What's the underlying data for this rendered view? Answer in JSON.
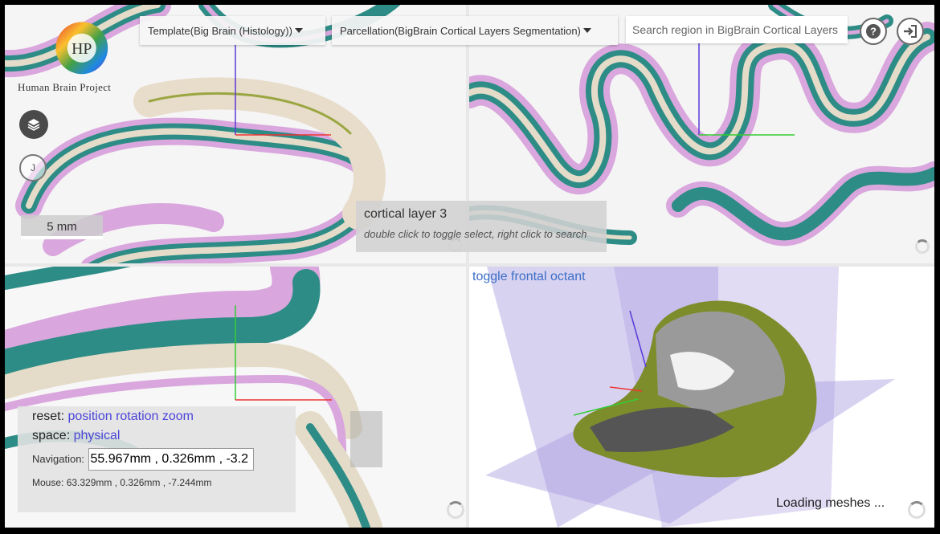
{
  "logo": {
    "initials": "HP",
    "text": "Human Brain Project"
  },
  "template": {
    "label": "Template",
    "value": "(Big Brain (Histology))"
  },
  "parcellation": {
    "label": "Parcellation",
    "value": "(BigBrain Cortical Layers Segmentation)"
  },
  "search": {
    "placeholder": "Search region in BigBrain Cortical Layers Segmentation"
  },
  "buttons": {
    "help_icon": "help-icon",
    "login_icon": "sign-in-icon",
    "layers_icon": "layers-icon",
    "user_initial": "J"
  },
  "scalebar": {
    "label": "5 mm"
  },
  "tooltip": {
    "title": "cortical layer 3",
    "hint": "double click to toggle select, right click to search"
  },
  "octant": {
    "toggle_label": "toggle frontal octant"
  },
  "nav": {
    "reset_label": "reset:",
    "reset_links": "position rotation zoom",
    "space_label": "space:",
    "space_value": "physical",
    "navigation_label": "Navigation:",
    "navigation_value": "55.967mm , 0.326mm , -3.2",
    "mouse_label": "Mouse:",
    "mouse_value": "63.329mm , 0.326mm , -7.244mm"
  },
  "status": {
    "loading": "Loading meshes ..."
  },
  "colors": {
    "teal": "#2e8c86",
    "pink": "#d9a6dd",
    "tan": "#e4dcc8",
    "olive": "#7e8d2c",
    "accent_link": "#3b6fc6",
    "plane": "#a99be0"
  }
}
